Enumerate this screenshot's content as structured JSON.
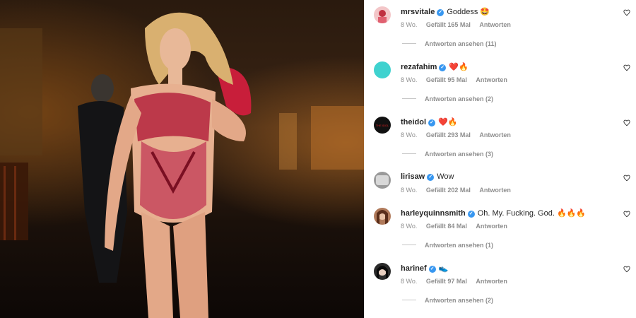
{
  "photo": {
    "alt_name": "post-photo"
  },
  "comments": [
    {
      "username": "mrsvitale",
      "text": "Goddess 🤩",
      "age": "8 Wo.",
      "likes": "Gefällt 165 Mal",
      "reply": "Antworten",
      "view_replies": "Antworten ansehen (11)",
      "avatar_color": "#f3c6c8"
    },
    {
      "username": "rezafahim",
      "text": "❤️🔥",
      "age": "8 Wo.",
      "likes": "Gefällt 95 Mal",
      "reply": "Antworten",
      "view_replies": "Antworten ansehen (2)",
      "avatar_color": "#3fd2cf"
    },
    {
      "username": "theidol",
      "text": "❤️🔥",
      "age": "8 Wo.",
      "likes": "Gefällt 293 Mal",
      "reply": "Antworten",
      "view_replies": "Antworten ansehen (3)",
      "avatar_color": "#111111",
      "avatar_text": "THE IDOL"
    },
    {
      "username": "lirisaw",
      "text": "Wow",
      "age": "8 Wo.",
      "likes": "Gefällt 202 Mal",
      "reply": "Antworten",
      "view_replies": "",
      "avatar_color": "#9a9a9a"
    },
    {
      "username": "harleyquinnsmith",
      "text": "Oh. My. Fucking. God. 🔥🔥🔥",
      "age": "8 Wo.",
      "likes": "Gefällt 84 Mal",
      "reply": "Antworten",
      "view_replies": "Antworten ansehen (1)",
      "avatar_color": "#b07a5a"
    },
    {
      "username": "harinef",
      "text": "👟",
      "age": "8 Wo.",
      "likes": "Gefällt 97 Mal",
      "reply": "Antworten",
      "view_replies": "Antworten ansehen (2)",
      "avatar_color": "#2b2b2b"
    }
  ],
  "icons": {
    "verified": "verified-badge-icon",
    "like": "heart-icon"
  },
  "colors": {
    "verified": "#3897f0",
    "muted": "#8e8e8e",
    "text": "#262626"
  }
}
